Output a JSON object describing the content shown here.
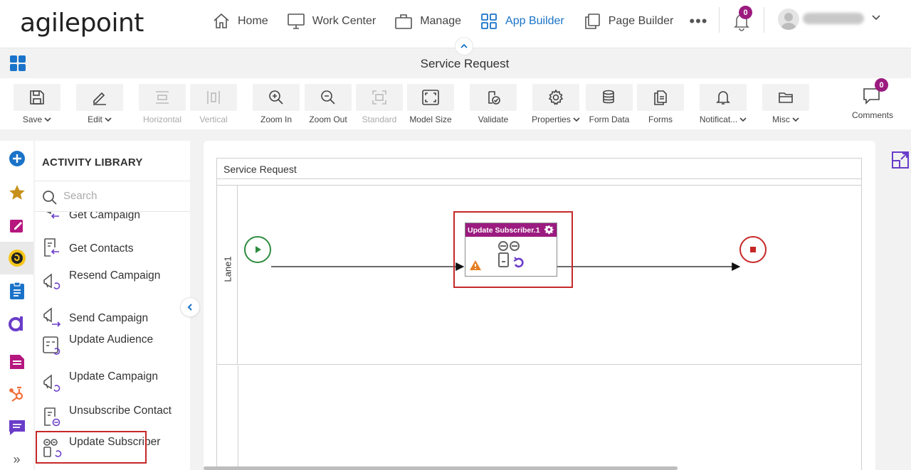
{
  "brand": {
    "logo_text": "agilepoint",
    "accent": "#1a73c9",
    "activity_color": "#9b1b7f"
  },
  "nav": {
    "items": [
      {
        "label": "Home",
        "icon": "home-icon"
      },
      {
        "label": "Work Center",
        "icon": "monitor-icon"
      },
      {
        "label": "Manage",
        "icon": "briefcase-icon"
      },
      {
        "label": "App Builder",
        "icon": "grid-icon",
        "active": true
      },
      {
        "label": "Page Builder",
        "icon": "copy-icon"
      }
    ],
    "more_label": "•••",
    "notifications_count": "0"
  },
  "header": {
    "page_title": "Service Request"
  },
  "toolbar": {
    "items": [
      {
        "label": "Save",
        "dropdown": true
      },
      {
        "label": "Edit",
        "dropdown": true
      },
      {
        "label": "Horizontal",
        "disabled": true
      },
      {
        "label": "Vertical",
        "disabled": true
      },
      {
        "label": "Zoom In"
      },
      {
        "label": "Zoom Out"
      },
      {
        "label": "Standard",
        "disabled": true
      },
      {
        "label": "Model Size"
      },
      {
        "label": "Validate"
      },
      {
        "label": "Properties",
        "dropdown": true
      },
      {
        "label": "Form Data"
      },
      {
        "label": "Forms"
      },
      {
        "label": "Notificat...",
        "dropdown": true
      },
      {
        "label": "Misc",
        "dropdown": true
      }
    ],
    "comments_label": "Comments",
    "comments_count": "0"
  },
  "library": {
    "title": "ACTIVITY LIBRARY",
    "search_placeholder": "Search",
    "items": [
      {
        "label": "Get Campaign"
      },
      {
        "label": "Get Contacts"
      },
      {
        "label": "Resend Campaign"
      },
      {
        "label": "Send Campaign"
      },
      {
        "label": "Update Audience"
      },
      {
        "label": "Update Campaign"
      },
      {
        "label": "Unsubscribe Contact"
      },
      {
        "label": "Update Subscriber"
      }
    ]
  },
  "canvas": {
    "pool_name": "Service Request",
    "lane_name": "Lane1",
    "activity_name": "Update Subscriber.1"
  },
  "rail": {
    "expand_label": "»"
  }
}
